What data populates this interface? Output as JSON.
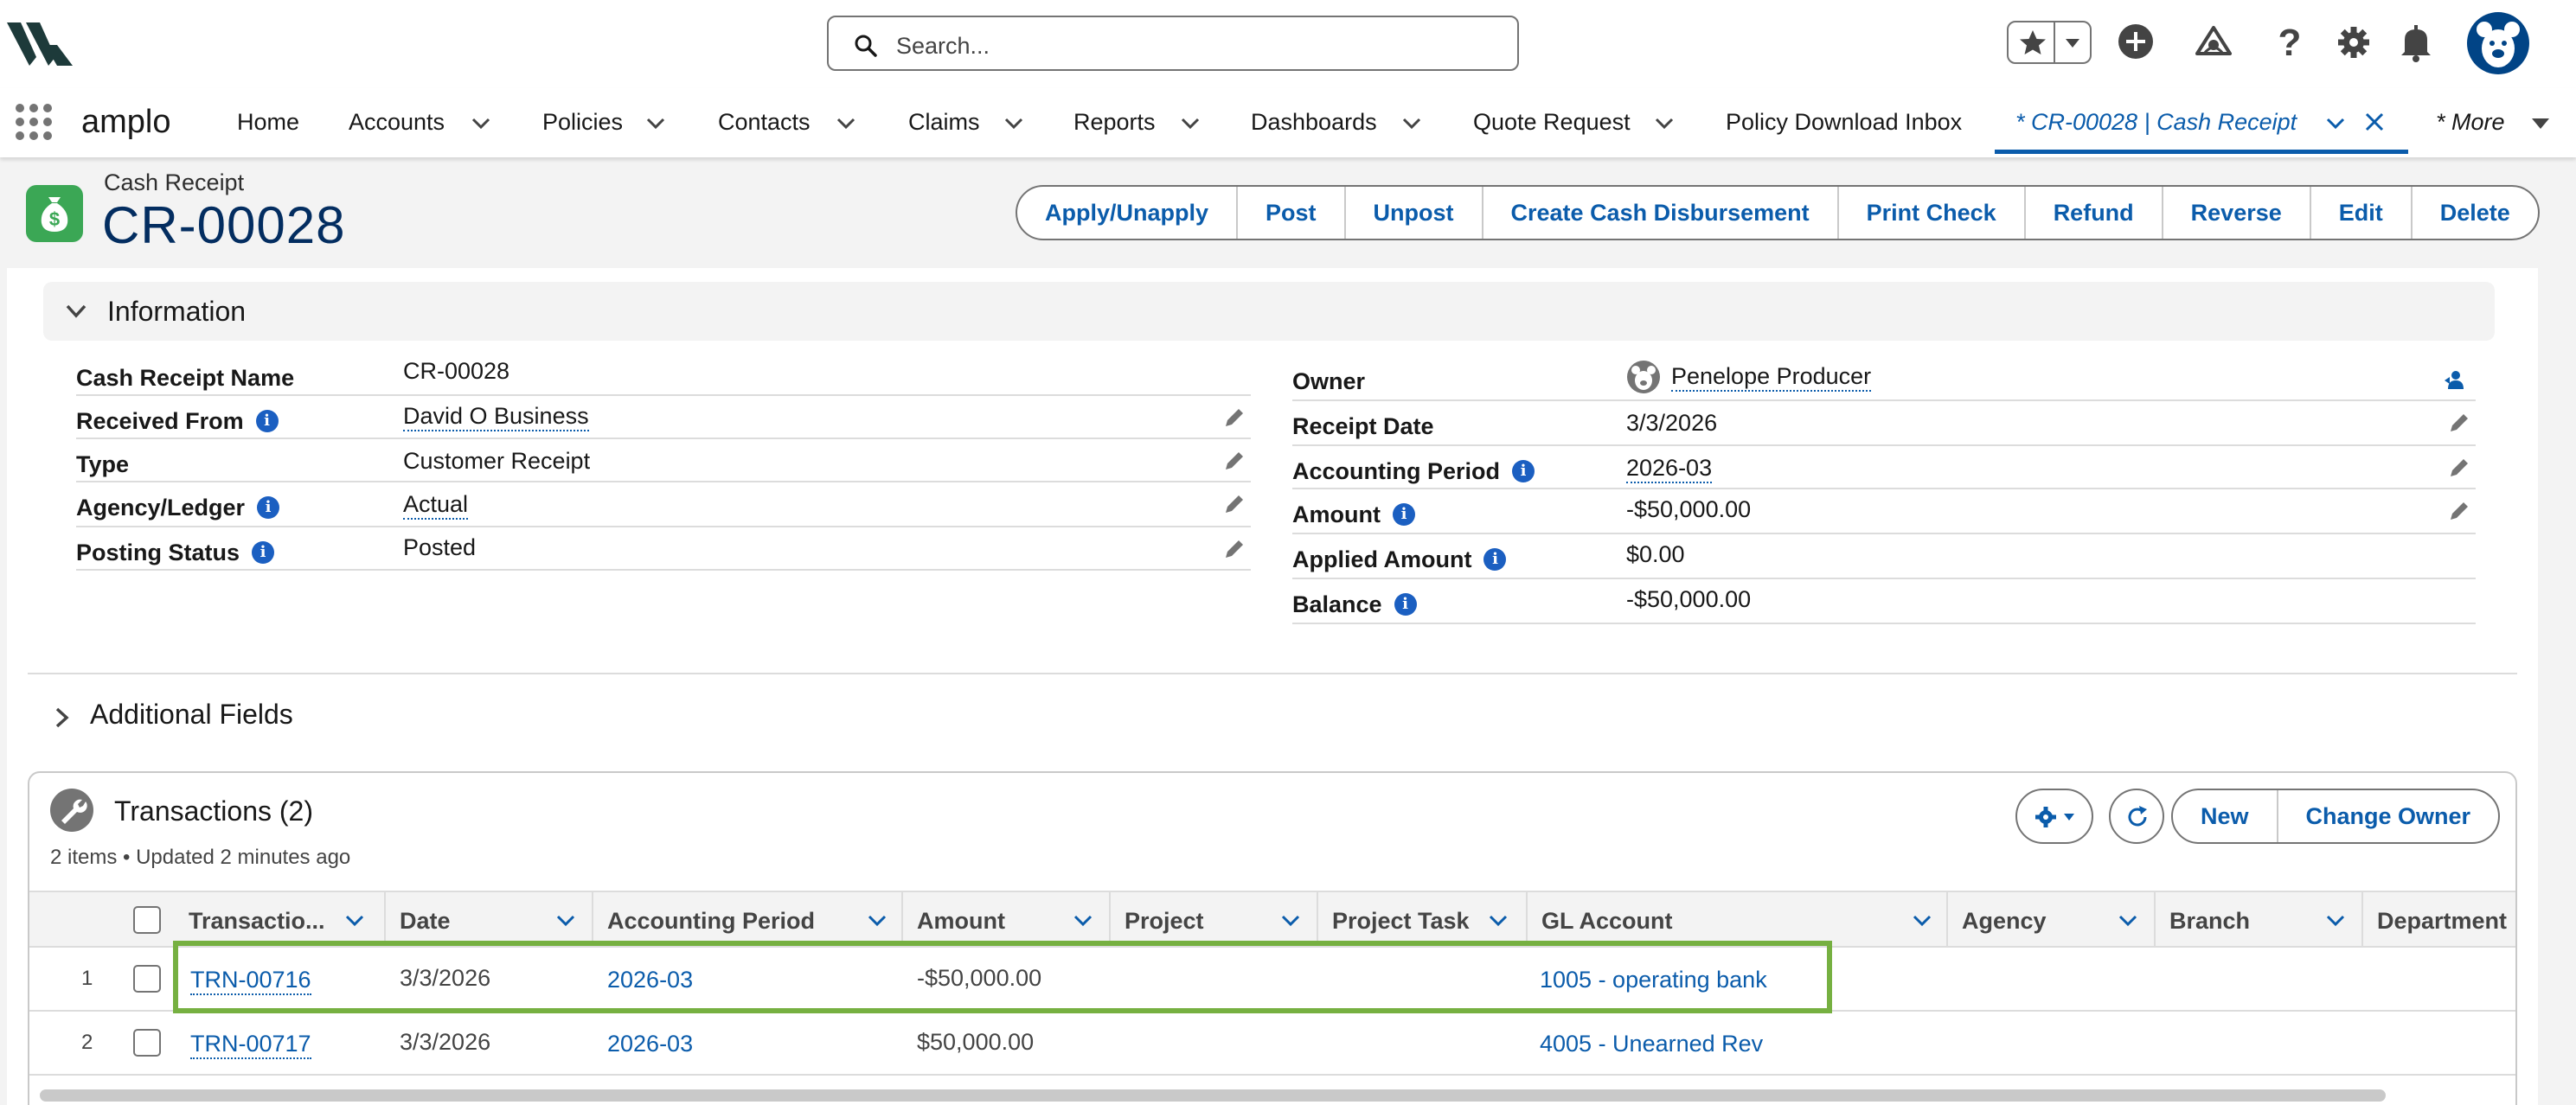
{
  "header": {
    "search_placeholder": "Search...",
    "icons": [
      "waffle-icon",
      "favorites-star-icon",
      "add-icon",
      "trailhead-icon",
      "help-icon",
      "setup-gear-icon",
      "notification-bell-icon",
      "user-avatar"
    ]
  },
  "nav": {
    "app_name": "amplo",
    "items": [
      {
        "label": "Home",
        "has_menu": false
      },
      {
        "label": "Accounts",
        "has_menu": true
      },
      {
        "label": "Policies",
        "has_menu": true
      },
      {
        "label": "Contacts",
        "has_menu": true
      },
      {
        "label": "Claims",
        "has_menu": true
      },
      {
        "label": "Reports",
        "has_menu": true
      },
      {
        "label": "Dashboards",
        "has_menu": true
      },
      {
        "label": "Quote Request",
        "has_menu": true
      },
      {
        "label": "Policy Download Inbox",
        "has_menu": false
      }
    ],
    "active_tab": "* CR-00028 | Cash Receipt",
    "more_label": "* More"
  },
  "record": {
    "object_type": "Cash Receipt",
    "name": "CR-00028",
    "actions": [
      "Apply/Unapply",
      "Post",
      "Unpost",
      "Create Cash Disbursement",
      "Print Check",
      "Refund",
      "Reverse",
      "Edit",
      "Delete"
    ]
  },
  "information": {
    "title": "Information",
    "left": [
      {
        "label": "Cash Receipt Name",
        "value": "CR-00028",
        "link": false,
        "info": false,
        "editable": false
      },
      {
        "label": "Received From",
        "value": "David O Business",
        "link": true,
        "info": true,
        "editable": true
      },
      {
        "label": "Type",
        "value": "Customer Receipt",
        "link": false,
        "info": false,
        "editable": true
      },
      {
        "label": "Agency/Ledger",
        "value": "Actual",
        "link": true,
        "info": true,
        "editable": true
      },
      {
        "label": "Posting Status",
        "value": "Posted",
        "link": false,
        "info": true,
        "editable": true
      }
    ],
    "right": [
      {
        "label": "Owner",
        "value": "Penelope Producer",
        "link": true,
        "info": false,
        "editable": false
      },
      {
        "label": "Receipt Date",
        "value": "3/3/2026",
        "link": false,
        "info": false,
        "editable": true
      },
      {
        "label": "Accounting Period",
        "value": "2026-03",
        "link": true,
        "info": true,
        "editable": true
      },
      {
        "label": "Amount",
        "value": "-$50,000.00",
        "link": false,
        "info": true,
        "editable": true
      },
      {
        "label": "Applied Amount",
        "value": "$0.00",
        "link": false,
        "info": true,
        "editable": false
      },
      {
        "label": "Balance",
        "value": "-$50,000.00",
        "link": false,
        "info": true,
        "editable": false
      }
    ]
  },
  "additional_fields": {
    "title": "Additional Fields"
  },
  "transactions": {
    "title": "Transactions (2)",
    "subtitle": "2 items • Updated 2 minutes ago",
    "buttons": [
      "New",
      "Change Owner"
    ],
    "columns": [
      "Transactio...",
      "Date",
      "Accounting Period",
      "Amount",
      "Project",
      "Project Task",
      "GL Account",
      "Agency",
      "Branch",
      "Department"
    ],
    "rows": [
      {
        "num": "1",
        "id": "TRN-00716",
        "date": "3/3/2026",
        "period": "2026-03",
        "amount": "-$50,000.00",
        "gl": "1005 - operating bank",
        "highlighted": true
      },
      {
        "num": "2",
        "id": "TRN-00717",
        "date": "3/3/2026",
        "period": "2026-03",
        "amount": "$50,000.00",
        "gl": "4005 - Unearned Rev",
        "highlighted": false
      }
    ]
  },
  "colors": {
    "brand_blue": "#0b5cab",
    "title_navy": "#032d60",
    "record_icon_green": "#3ba755",
    "highlight_green": "#76b041"
  }
}
